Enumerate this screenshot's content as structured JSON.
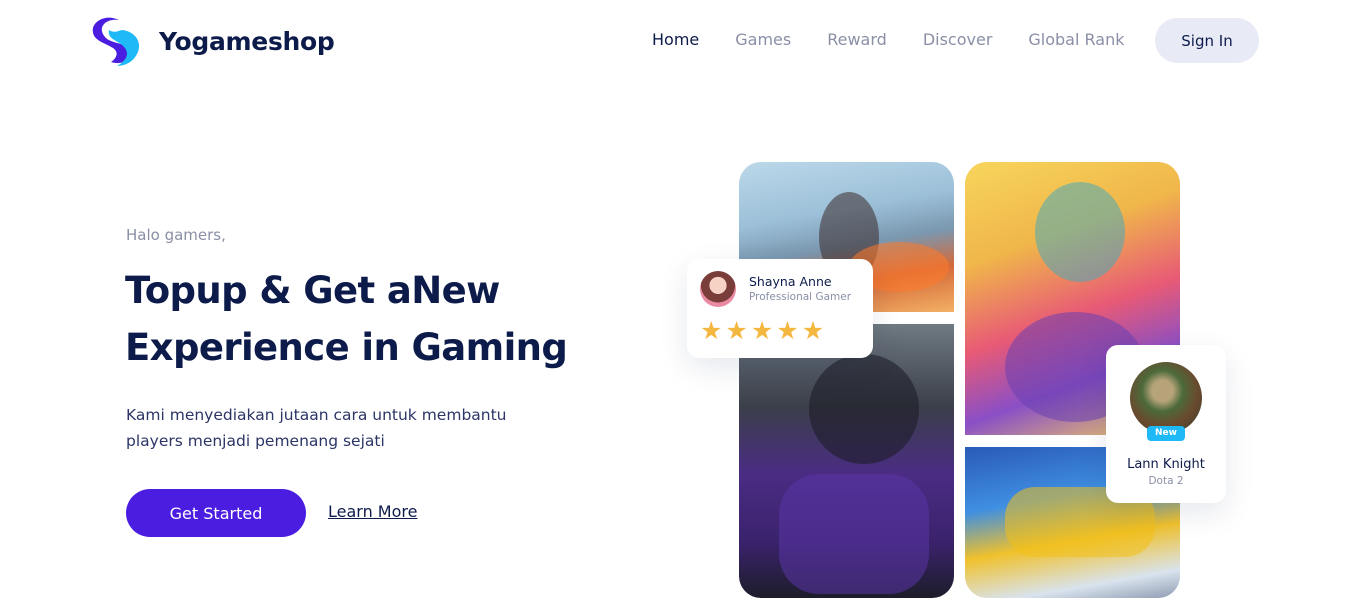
{
  "brand": {
    "name": "Yogameshop",
    "colors": {
      "primary": "#4a1de0",
      "accent": "#1fb9f7",
      "navy": "#0d1b4b"
    }
  },
  "nav": {
    "items": [
      {
        "label": "Home",
        "active": true
      },
      {
        "label": "Games",
        "active": false
      },
      {
        "label": "Reward",
        "active": false
      },
      {
        "label": "Discover",
        "active": false
      },
      {
        "label": "Global Rank",
        "active": false
      }
    ],
    "signin_label": "Sign In"
  },
  "hero": {
    "greeting": "Halo gamers,",
    "headline_part1": "Topup & Get a",
    "headline_highlight1": " New",
    "headline_highlight2": "Experience",
    "headline_part2": " in Gaming",
    "description": "Kami menyediakan jutaan cara untuk membantu players menjadi pemenang sejati",
    "cta_primary": "Get Started",
    "cta_secondary": "Learn More"
  },
  "gallery": {
    "tiles": [
      "battlefield-tile",
      "football-tile",
      "brawler-tile",
      "racing-tile"
    ]
  },
  "user_card": {
    "name": "Shayna Anne",
    "role": "Professional Gamer",
    "rating": 5,
    "star_icon": "star-icon"
  },
  "game_card": {
    "badge": "New",
    "name": "Lann Knight",
    "game": "Dota 2"
  }
}
